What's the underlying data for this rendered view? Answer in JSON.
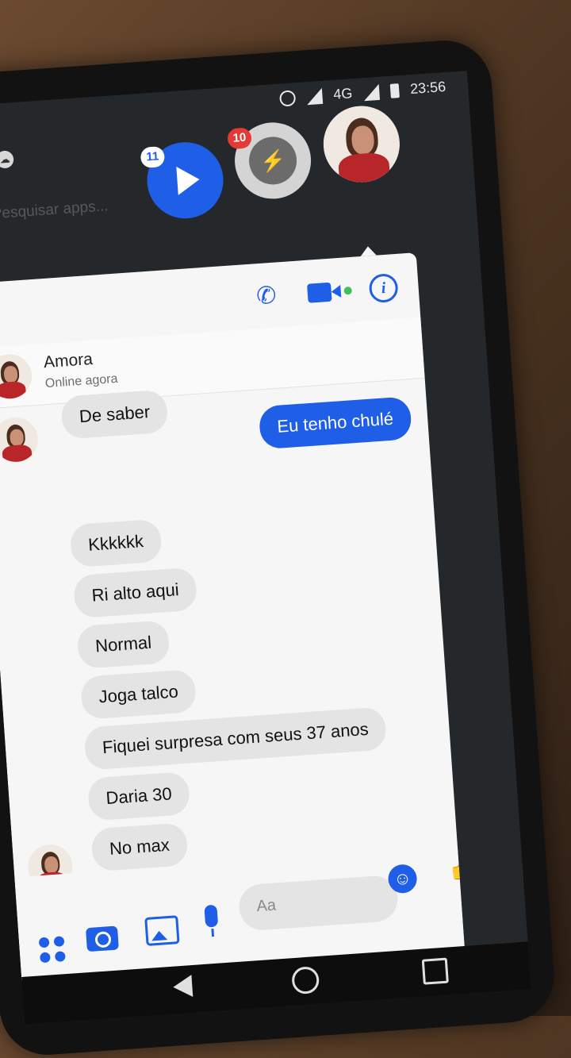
{
  "status_bar": {
    "network": "4G",
    "time": "23:56"
  },
  "search_apps": "Pesquisar apps...",
  "chat_heads": {
    "video_badge": "11",
    "messenger_badge": "10",
    "messenger_glyph": "⚡"
  },
  "contact": {
    "name": "Amora",
    "status": "Online agora"
  },
  "toolbar": {
    "phone_glyph": "✆",
    "info_glyph": "i"
  },
  "messages": [
    {
      "dir": "in",
      "text": "De saber"
    },
    {
      "dir": "out",
      "text": "Eu tenho chulé"
    },
    {
      "dir": "in",
      "text": "Kkkkkk"
    },
    {
      "dir": "in",
      "text": "Ri alto aqui"
    },
    {
      "dir": "in",
      "text": "Normal"
    },
    {
      "dir": "in",
      "text": "Joga talco"
    },
    {
      "dir": "in",
      "text": "Fiquei surpresa com seus 37 anos"
    },
    {
      "dir": "in",
      "text": "Daria 30"
    },
    {
      "dir": "in",
      "text": "No max"
    }
  ],
  "composer": {
    "placeholder": "Aa",
    "emoji_glyph": "☺",
    "like_glyph": "👍"
  },
  "colors": {
    "accent": "#1f5ee6",
    "incoming_bubble": "#e4e4e4",
    "online_dot": "#3bc257",
    "badge_red": "#e53935"
  }
}
